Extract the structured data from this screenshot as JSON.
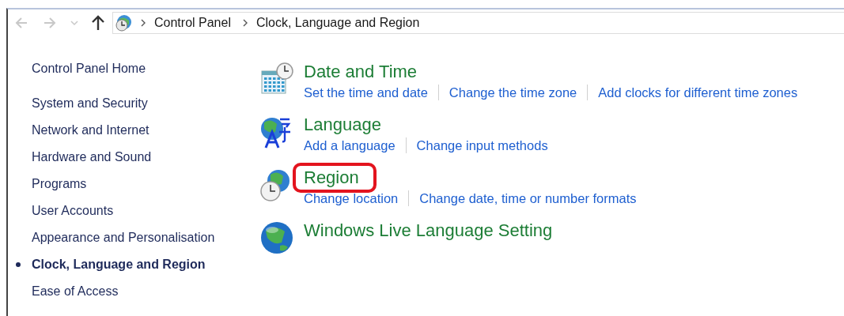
{
  "navigation": {
    "back_disabled": true,
    "forward_disabled": true
  },
  "breadcrumb": [
    "Control Panel",
    "Clock, Language and Region"
  ],
  "sidebar": {
    "home": "Control Panel Home",
    "items": [
      {
        "label": "System and Security",
        "selected": false
      },
      {
        "label": "Network and Internet",
        "selected": false
      },
      {
        "label": "Hardware and Sound",
        "selected": false
      },
      {
        "label": "Programs",
        "selected": false
      },
      {
        "label": "User Accounts",
        "selected": false
      },
      {
        "label": "Appearance and Personalisation",
        "selected": false
      },
      {
        "label": "Clock, Language and Region",
        "selected": true
      },
      {
        "label": "Ease of Access",
        "selected": false
      }
    ]
  },
  "categories": [
    {
      "kind": "datetime",
      "title": "Date and Time",
      "highlighted": false,
      "links": [
        "Set the time and date",
        "Change the time zone",
        "Add clocks for different time zones"
      ]
    },
    {
      "kind": "language",
      "title": "Language",
      "highlighted": false,
      "links": [
        "Add a language",
        "Change input methods"
      ]
    },
    {
      "kind": "region",
      "title": "Region",
      "highlighted": true,
      "links": [
        "Change location",
        "Change date, time or number formats"
      ]
    },
    {
      "kind": "globe",
      "title": "Windows Live Language Setting",
      "highlighted": false
    }
  ]
}
